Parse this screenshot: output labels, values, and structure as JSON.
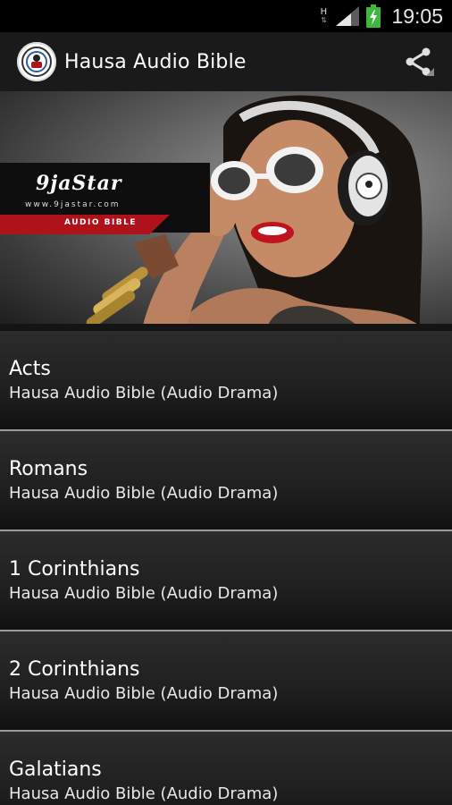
{
  "statusbar": {
    "network_letter": "H",
    "network_arrows": "⇅",
    "time": "19:05"
  },
  "actionbar": {
    "title": "Hausa Audio Bible"
  },
  "banner": {
    "brand_name": "9jaStar",
    "brand_url": "www.9jastar.com",
    "brand_sub": "AUDIO BIBLE"
  },
  "list": {
    "items": [
      {
        "title": "Acts",
        "subtitle": "Hausa Audio Bible (Audio Drama)"
      },
      {
        "title": "Romans",
        "subtitle": "Hausa Audio Bible (Audio Drama)"
      },
      {
        "title": "1 Corinthians",
        "subtitle": "Hausa Audio Bible (Audio Drama)"
      },
      {
        "title": "2 Corinthians",
        "subtitle": "Hausa Audio Bible (Audio Drama)"
      },
      {
        "title": "Galatians",
        "subtitle": "Hausa Audio Bible (Audio Drama)"
      }
    ]
  },
  "colors": {
    "accent_red": "#b0121c",
    "row_divider": "#9a9a9a",
    "battery_green": "#3fb73f"
  },
  "icons": [
    "signal-icon",
    "battery-icon",
    "app-logo-icon",
    "share-icon"
  ]
}
